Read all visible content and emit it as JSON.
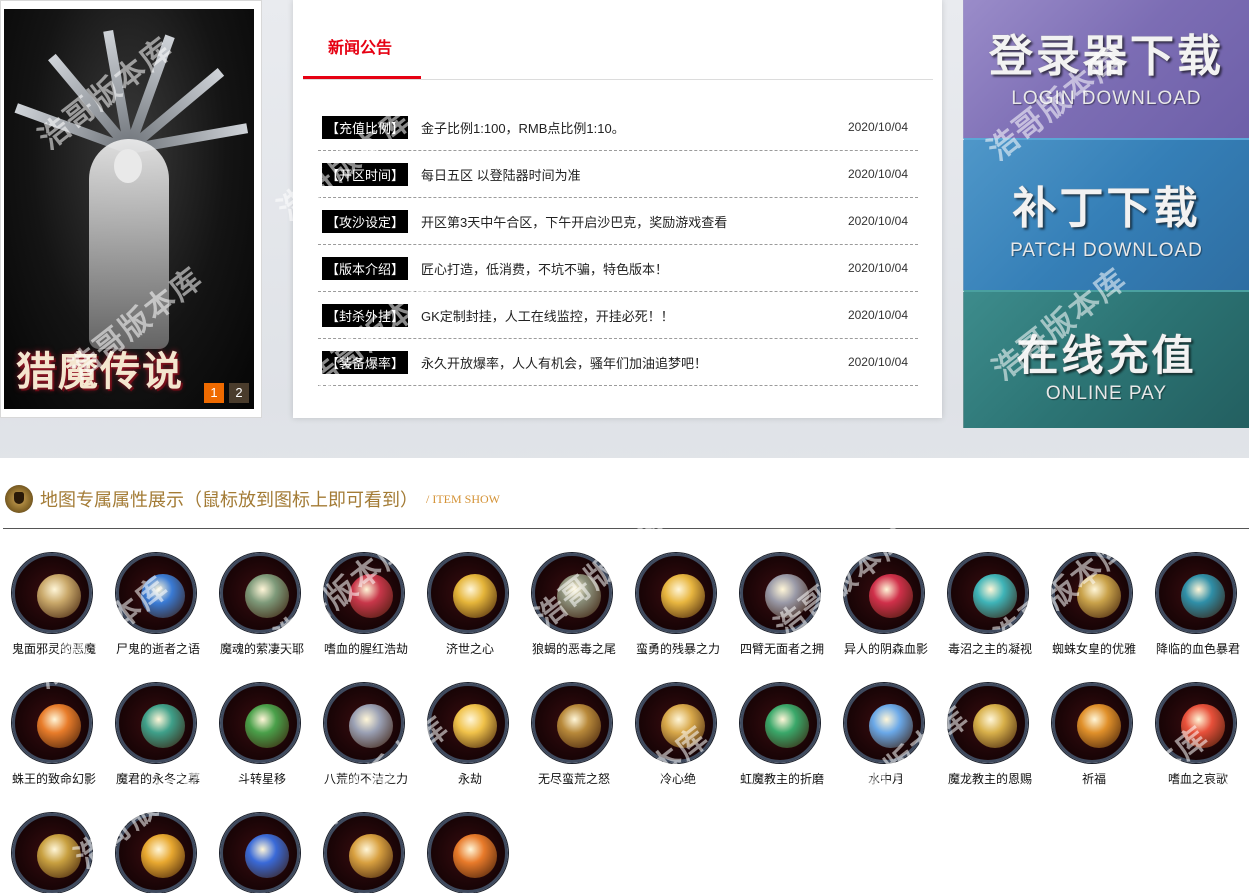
{
  "banner": {
    "title": "猎魔传说",
    "pages": [
      "1",
      "2"
    ]
  },
  "notice": {
    "tab": "新闻公告",
    "rows": [
      {
        "tag": "【充值比例】",
        "text": "金子比例1:100，RMB点比例1:10。",
        "date": "2020/10/04"
      },
      {
        "tag": "【开区时间】",
        "text": "每日五区 以登陆器时间为准",
        "date": "2020/10/04"
      },
      {
        "tag": "【攻沙设定】",
        "text": "开区第3天中午合区，下午开启沙巴克，奖励游戏查看",
        "date": "2020/10/04"
      },
      {
        "tag": "【版本介绍】",
        "text": "匠心打造，低消费，不坑不骗，特色版本！",
        "date": "2020/10/04"
      },
      {
        "tag": "【封杀外挂】",
        "text": "GK定制封挂，人工在线监控，开挂必死！！",
        "date": "2020/10/04"
      },
      {
        "tag": "【装备爆率】",
        "text": "永久开放爆率，人人有机会，骚年们加油追梦吧！",
        "date": "2020/10/04"
      }
    ]
  },
  "downloads": {
    "login": {
      "cn": "登录器下载",
      "en": "LOGIN DOWNLOAD"
    },
    "patch": {
      "cn": "补丁下载",
      "en": "PATCH DOWNLOAD"
    },
    "pay": {
      "cn": "在线充值",
      "en": "ONLINE PAY"
    }
  },
  "items": {
    "title": "地图专属属性展示（鼠标放到图标上即可看到）",
    "subtitle": "/ ITEM SHOW",
    "list": [
      {
        "name": "鬼面邪灵的恶魔",
        "color": "#c9a86a"
      },
      {
        "name": "尸鬼的逝者之语",
        "color": "#3a7bd5"
      },
      {
        "name": "魔魂的萦凄天耶",
        "color": "#7e9a7a"
      },
      {
        "name": "嗜血的腥红浩劫",
        "color": "#c8374a"
      },
      {
        "name": "济世之心",
        "color": "#e5b53a"
      },
      {
        "name": "狼蝎的恶毒之尾",
        "color": "#8b8f7a"
      },
      {
        "name": "蛮勇的残暴之力",
        "color": "#e8b640"
      },
      {
        "name": "四臂无面者之拥",
        "color": "#9a9aa8"
      },
      {
        "name": "异人的阴森血影",
        "color": "#d0304a"
      },
      {
        "name": "毒沼之主的凝视",
        "color": "#3fb4b8"
      },
      {
        "name": "蜘蛛女皇的优雅",
        "color": "#c9a24a"
      },
      {
        "name": "降临的血色暴君",
        "color": "#2f8fa8"
      },
      {
        "name": "蛛王的致命幻影",
        "color": "#e87c2a"
      },
      {
        "name": "魔君的永冬之幕",
        "color": "#3fa08a"
      },
      {
        "name": "斗转星移",
        "color": "#4aa04a"
      },
      {
        "name": "八荒的不洁之力",
        "color": "#9aa0b4"
      },
      {
        "name": "永劫",
        "color": "#f0c24a"
      },
      {
        "name": "无尽蛮荒之怒",
        "color": "#b8893a"
      },
      {
        "name": "冷心绝",
        "color": "#d8a84a"
      },
      {
        "name": "虹魔教主的折磨",
        "color": "#3aa86a"
      },
      {
        "name": "水中月",
        "color": "#6aa8e8"
      },
      {
        "name": "魔龙教主的恩赐",
        "color": "#d8b04a"
      },
      {
        "name": "祈福",
        "color": "#e0902a"
      },
      {
        "name": "嗜血之哀歌",
        "color": "#e8503a"
      },
      {
        "name": "",
        "color": "#c8a040"
      },
      {
        "name": "",
        "color": "#e8a830"
      },
      {
        "name": "",
        "color": "#3a6ad8"
      },
      {
        "name": "",
        "color": "#d8a040"
      },
      {
        "name": "",
        "color": "#e87a2a"
      }
    ]
  },
  "watermark": "浩哥版本库"
}
